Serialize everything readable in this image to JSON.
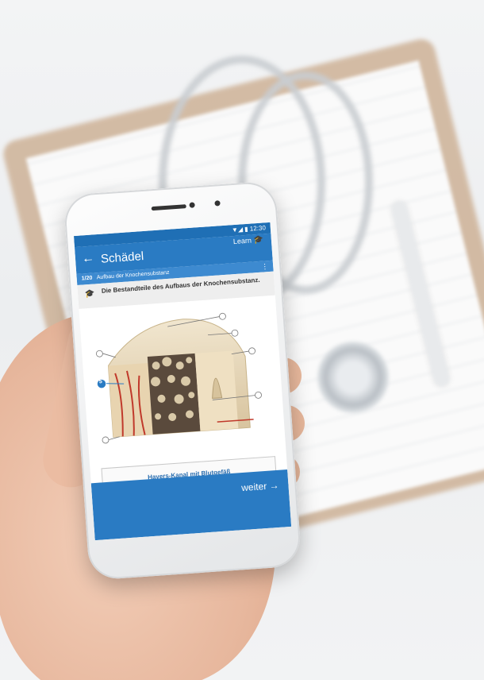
{
  "status": {
    "time": "12:30"
  },
  "appbar": {
    "back_icon": "←",
    "title": "Schädel",
    "mode_label": "Learn",
    "mode_icon": "graduation-cap-icon"
  },
  "lesson": {
    "progress": "1/20",
    "topic": "Aufbau der Knochensubstanz",
    "more_icon": "more-vert-icon"
  },
  "question": {
    "icon": "graduation-cap-icon",
    "text": "Die Bestandteile des Aufbaus der Knochensubstanz."
  },
  "figure": {
    "selected_marker": "5"
  },
  "answer": {
    "label": "Havers-Kanal mit Blutgefäß"
  },
  "footer": {
    "next_label": "weiter",
    "next_icon": "→"
  },
  "colors": {
    "primary": "#2a7bc3",
    "statusbar": "#1f6fb5",
    "subbar": "#3d8ad0"
  }
}
